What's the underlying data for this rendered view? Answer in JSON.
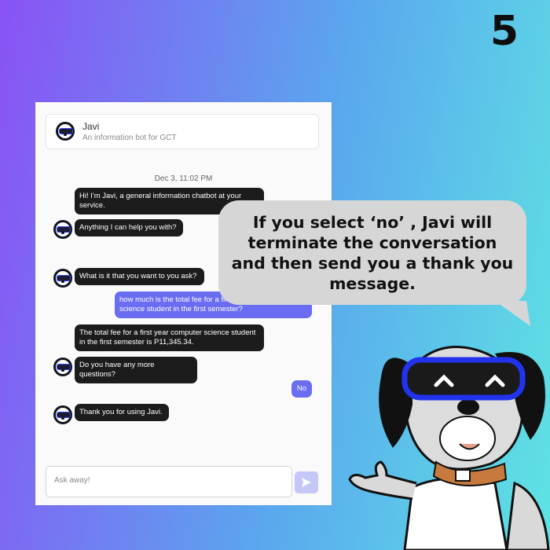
{
  "step_number": "5",
  "chat": {
    "bot_name": "Javi",
    "bot_description": "An information bot for GCT",
    "timestamp": "Dec 3, 11:02 PM",
    "messages": [
      {
        "sender": "bot",
        "text": "Hi! I'm Javi, a general information chatbot at your service."
      },
      {
        "sender": "bot",
        "text": "Anything I can help you with?"
      },
      {
        "sender": "bot",
        "text": "What is it that you want to you ask?"
      },
      {
        "sender": "user",
        "text": "how much is the total fee for a first year computer science student in the first semester?"
      },
      {
        "sender": "bot",
        "text": "The total fee for a first year computer science student in the first semester is P11,345.34."
      },
      {
        "sender": "bot",
        "text": "Do you have any more questions?"
      },
      {
        "sender": "user",
        "text": "No"
      },
      {
        "sender": "bot",
        "text": "Thank you for using Javi."
      }
    ],
    "input_placeholder": "Ask away!",
    "send_icon": "send-arrow-icon"
  },
  "callout": {
    "text": "If you select ‘no’ , Javi will terminate the conversation and then send you a thank you message."
  },
  "colors": {
    "bot_bubble": "#1c1c1c",
    "user_bubble": "#6a6cf2",
    "send_button": "#c5c7f7",
    "mascot_goggles": "#2233ee",
    "mascot_collar": "#c87a3e"
  }
}
